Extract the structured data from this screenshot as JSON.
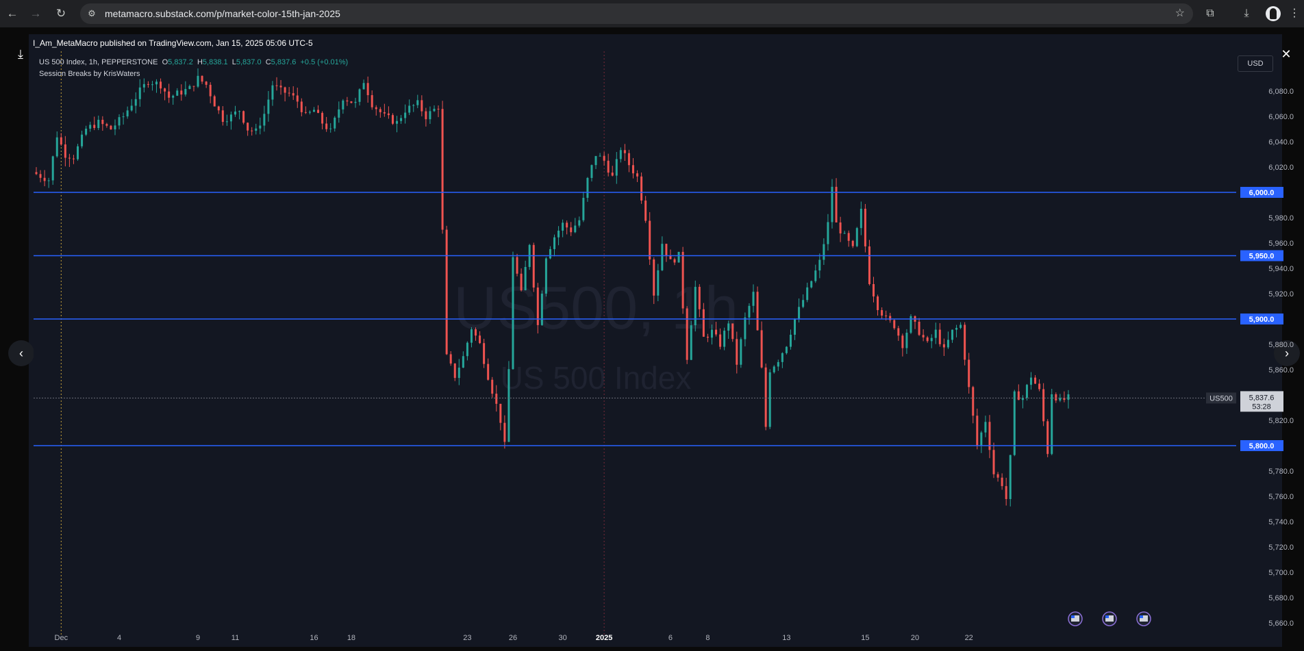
{
  "browser": {
    "url": "metamacro.substack.com/p/market-color-15th-jan-2025"
  },
  "caption": "I_Am_MetaMacro published on TradingView.com, Jan 15, 2025 05:06 UTC-5",
  "legend": {
    "symbol": "US 500 Index, 1h, PEPPERSTONE",
    "o_label": "O",
    "o_value": "5,837.2",
    "h_label": "H",
    "h_value": "5,838.1",
    "l_label": "L",
    "l_value": "5,837.0",
    "c_label": "C",
    "c_value": "5,837.6",
    "change": "+0.5 (+0.01%)",
    "indicator": "Session Breaks by KrisWaters"
  },
  "watermark": {
    "main": "US500, 1h",
    "sub": "US 500 Index"
  },
  "currency_button": "USD",
  "colors": {
    "up": "#26a69a",
    "down": "#ef5350",
    "level_line": "#2962ff",
    "background": "#131722"
  },
  "chart_data": {
    "type": "candlestick",
    "symbol": "US500",
    "interval": "1h",
    "ylim": [
      5650,
      6100
    ],
    "y_ticks": [
      5660,
      5680,
      5700,
      5720,
      5740,
      5760,
      5780,
      5800,
      5820,
      5840,
      5860,
      5880,
      5900,
      5920,
      5940,
      5960,
      5980,
      6000,
      6020,
      6040,
      6060,
      6080
    ],
    "y_tick_labels": [
      "5,660.0",
      "5,680.0",
      "5,700.0",
      "5,720.0",
      "5,740.0",
      "5,760.0",
      "5,780.0",
      "5,800.0",
      "5,820.0",
      "5,840.0",
      "5,860.0",
      "5,880.0",
      "5,900.0",
      "5,920.0",
      "5,940.0",
      "5,960.0",
      "5,980.0",
      "6,000.0",
      "6,020.0",
      "6,040.0",
      "6,060.0",
      "6,080.0"
    ],
    "x_tick_labels": [
      "Dec",
      "4",
      "9",
      "11",
      "16",
      "18",
      "23",
      "26",
      "30",
      "2025",
      "6",
      "8",
      "13",
      "15",
      "20",
      "22"
    ],
    "horizontal_levels": [
      6000,
      5950,
      5900,
      5800
    ],
    "horizontal_level_labels": [
      "6,000.0",
      "5,950.0",
      "5,900.0",
      "5,800.0"
    ],
    "last_price": 5837.6,
    "last_price_label": "5,837.6",
    "countdown": "53:28",
    "symbol_tag": "US500",
    "price_path": [
      [
        0,
        6016
      ],
      [
        4,
        6010
      ],
      [
        6,
        6045
      ],
      [
        8,
        6030
      ],
      [
        10,
        6028
      ],
      [
        13,
        6050
      ],
      [
        16,
        6055
      ],
      [
        19,
        6050
      ],
      [
        22,
        6060
      ],
      [
        24,
        6070
      ],
      [
        26,
        6080
      ],
      [
        28,
        6088
      ],
      [
        31,
        6085
      ],
      [
        33,
        6075
      ],
      [
        35,
        6078
      ],
      [
        38,
        6082
      ],
      [
        40,
        6090
      ],
      [
        42,
        6085
      ],
      [
        44,
        6070
      ],
      [
        46,
        6058
      ],
      [
        48,
        6060
      ],
      [
        50,
        6065
      ],
      [
        52,
        6050
      ],
      [
        54,
        6048
      ],
      [
        56,
        6062
      ],
      [
        58,
        6085
      ],
      [
        60,
        6080
      ],
      [
        62,
        6078
      ],
      [
        64,
        6072
      ],
      [
        66,
        6060
      ],
      [
        68,
        6065
      ],
      [
        70,
        6055
      ],
      [
        72,
        6048
      ],
      [
        75,
        6075
      ],
      [
        78,
        6070
      ],
      [
        80,
        6088
      ],
      [
        82,
        6070
      ],
      [
        85,
        6060
      ],
      [
        88,
        6055
      ],
      [
        90,
        6065
      ],
      [
        93,
        6070
      ],
      [
        95,
        6060
      ],
      [
        98,
        6068
      ],
      [
        100,
        5870
      ],
      [
        102,
        5855
      ],
      [
        104,
        5870
      ],
      [
        106,
        5893
      ],
      [
        108,
        5880
      ],
      [
        110,
        5855
      ],
      [
        112,
        5832
      ],
      [
        113,
        5820
      ],
      [
        114,
        5800
      ],
      [
        115,
        5860
      ],
      [
        116,
        5950
      ],
      [
        118,
        5920
      ],
      [
        120,
        5960
      ],
      [
        122,
        5895
      ],
      [
        124,
        5950
      ],
      [
        126,
        5965
      ],
      [
        128,
        5975
      ],
      [
        130,
        5970
      ],
      [
        132,
        5978
      ],
      [
        134,
        6010
      ],
      [
        136,
        6030
      ],
      [
        138,
        6025
      ],
      [
        140,
        6012
      ],
      [
        142,
        6035
      ],
      [
        144,
        6022
      ],
      [
        146,
        6012
      ],
      [
        148,
        5980
      ],
      [
        150,
        5920
      ],
      [
        152,
        5960
      ],
      [
        154,
        5945
      ],
      [
        156,
        5950
      ],
      [
        158,
        5870
      ],
      [
        160,
        5925
      ],
      [
        162,
        5885
      ],
      [
        164,
        5890
      ],
      [
        166,
        5880
      ],
      [
        168,
        5898
      ],
      [
        170,
        5865
      ],
      [
        172,
        5900
      ],
      [
        174,
        5920
      ],
      [
        176,
        5860
      ],
      [
        177,
        5815
      ],
      [
        178,
        5860
      ],
      [
        180,
        5868
      ],
      [
        182,
        5880
      ],
      [
        184,
        5900
      ],
      [
        186,
        5915
      ],
      [
        188,
        5930
      ],
      [
        190,
        5945
      ],
      [
        192,
        5975
      ],
      [
        193,
        6005
      ],
      [
        194,
        5975
      ],
      [
        196,
        5965
      ],
      [
        198,
        5955
      ],
      [
        200,
        5985
      ],
      [
        202,
        5930
      ],
      [
        204,
        5910
      ],
      [
        206,
        5900
      ],
      [
        208,
        5895
      ],
      [
        210,
        5880
      ],
      [
        212,
        5900
      ],
      [
        214,
        5890
      ],
      [
        216,
        5880
      ],
      [
        218,
        5890
      ],
      [
        220,
        5875
      ],
      [
        222,
        5890
      ],
      [
        224,
        5895
      ],
      [
        226,
        5845
      ],
      [
        228,
        5800
      ],
      [
        230,
        5820
      ],
      [
        232,
        5778
      ],
      [
        234,
        5770
      ],
      [
        235,
        5758
      ],
      [
        236,
        5790
      ],
      [
        237,
        5840
      ],
      [
        239,
        5838
      ],
      [
        241,
        5855
      ],
      [
        243,
        5843
      ],
      [
        245,
        5795
      ],
      [
        246,
        5842
      ],
      [
        248,
        5835
      ],
      [
        250,
        5837.6
      ]
    ],
    "x_tick_bar_index": [
      6,
      20,
      39,
      48,
      67,
      76,
      104,
      115,
      127,
      137,
      153,
      162,
      181,
      200,
      212,
      225
    ]
  }
}
